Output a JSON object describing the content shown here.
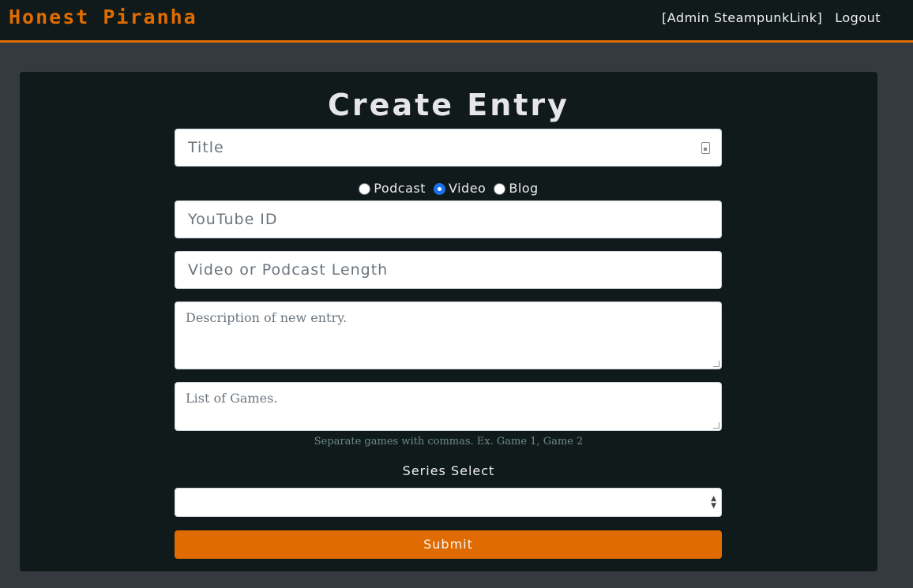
{
  "navbar": {
    "brand": "Honest Piranha",
    "admin_link": "[Admin SteampunkLink]",
    "logout": "Logout"
  },
  "form": {
    "heading": "Create Entry",
    "title_placeholder": "Title",
    "entry_types": [
      {
        "label": "Podcast",
        "checked": false
      },
      {
        "label": "Video",
        "checked": true
      },
      {
        "label": "Blog",
        "checked": false
      }
    ],
    "youtube_placeholder": "YouTube ID",
    "length_placeholder": "Video or Podcast Length",
    "description_placeholder": "Description of new entry.",
    "games_placeholder": "List of Games.",
    "games_help": "Separate games with commas. Ex. Game 1, Game 2",
    "series_label": "Series Select",
    "series_selected": "",
    "submit_label": "Submit"
  },
  "colors": {
    "accent": "#e06b00",
    "background": "#343a40",
    "panel": "#101a1b"
  }
}
